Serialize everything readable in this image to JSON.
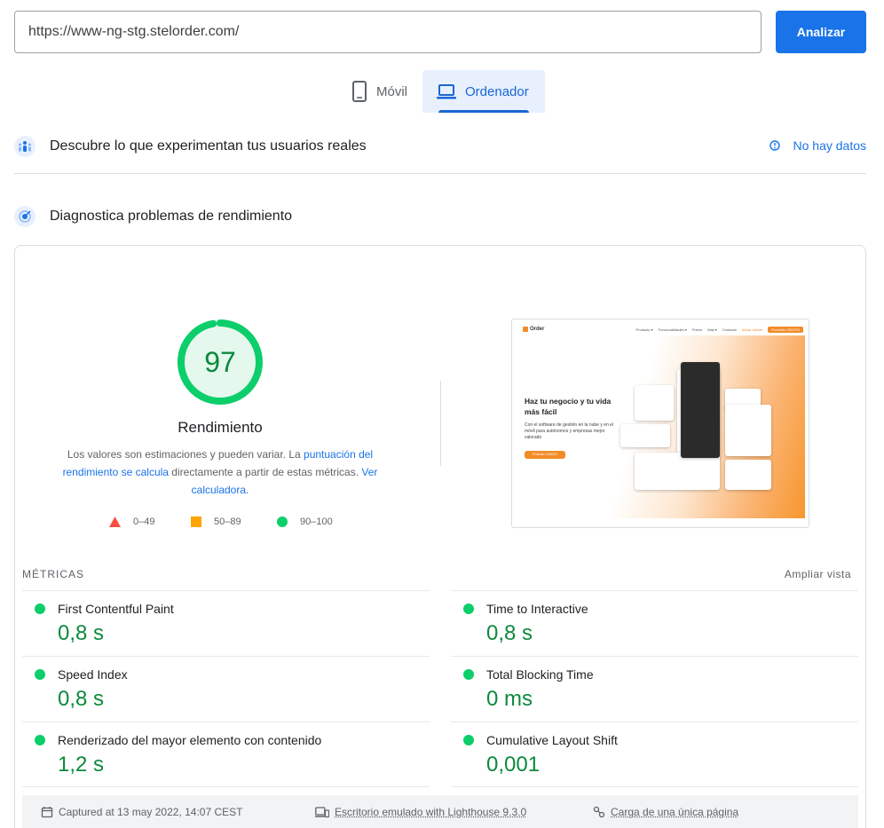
{
  "search": {
    "url_value": "https://www-ng-stg.stelorder.com/",
    "analyze_label": "Analizar"
  },
  "device_tabs": {
    "mobile_label": "Móvil",
    "desktop_label": "Ordenador",
    "selected": "Ordenador"
  },
  "real_users": {
    "title": "Descubre lo que experimentan tus usuarios reales",
    "no_data_label": "No hay datos"
  },
  "diagnostics": {
    "title": "Diagnostica problemas de rendimiento",
    "score": "97",
    "score_fraction": 0.97,
    "score_label": "Rendimiento",
    "desc_prefix": "Los valores son estimaciones y pueden variar. La ",
    "desc_link1": "puntuación del rendimiento se calcula",
    "desc_middle": " directamente a partir de estas métricas. ",
    "desc_link2": "Ver calculadora.",
    "legend": {
      "fail": "0–49",
      "average": "50–89",
      "pass": "90–100"
    }
  },
  "screenshot": {
    "logo": "Order",
    "nav": [
      "Producto ▾",
      "Funcionalidades ▾",
      "Precio",
      "Más ▾",
      "Contacto",
      "Iniciar sesión"
    ],
    "cta": "Pruébalo GRATIS",
    "headline": "Haz tu negocio y tu vida más fácil",
    "subhead": "Con el software de gestión en la nube y en el móvil para autónomos y empresas mejor valorado",
    "button": "Pruébalo GRATIS"
  },
  "metrics": {
    "section_label": "MÉTRICAS",
    "expand_label": "Ampliar vista",
    "items": [
      {
        "name": "First Contentful Paint",
        "value": "0,8 s"
      },
      {
        "name": "Time to Interactive",
        "value": "0,8 s"
      },
      {
        "name": "Speed Index",
        "value": "0,8 s"
      },
      {
        "name": "Total Blocking Time",
        "value": "0 ms"
      },
      {
        "name": "Renderizado del mayor elemento con contenido",
        "value": "1,2 s"
      },
      {
        "name": "Cumulative Layout Shift",
        "value": "0,001"
      }
    ]
  },
  "footer": {
    "captured": "Captured at 13 may 2022, 14:07 CEST",
    "emulation": "Escritorio emulado with Lighthouse 9.3.0",
    "load": "Carga de una única página"
  },
  "colors": {
    "accent": "#1a73e8",
    "pass": "#0cce6b",
    "pass_text": "#0c8a3c",
    "average": "#ffa400",
    "fail": "#ff4e42"
  }
}
